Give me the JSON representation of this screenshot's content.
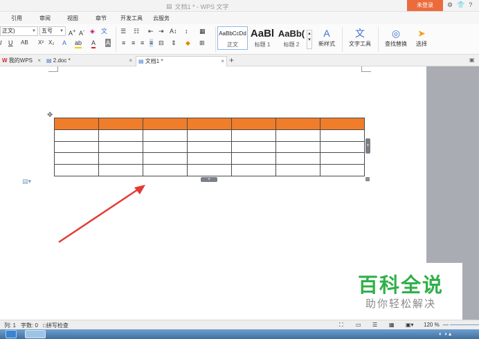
{
  "window": {
    "title": "文档1 * - WPS 文字",
    "login_button": "未登录"
  },
  "menu": [
    "引用",
    "审阅",
    "视图",
    "章节",
    "开发工具",
    "云服务"
  ],
  "ribbon": {
    "font_name": "正文)",
    "font_size": "五号",
    "styles": [
      {
        "preview": "AaBbCcDd",
        "label": "正文"
      },
      {
        "preview": "AaBl",
        "label": "标题 1"
      },
      {
        "preview": "AaBb(",
        "label": "标题 2"
      }
    ],
    "new_style": "新样式",
    "text_tools": "文字工具",
    "find_replace": "查找替换",
    "select": "选择"
  },
  "tabs": [
    {
      "label": "我的WPS"
    },
    {
      "label": "2.doc *"
    },
    {
      "label": "文档1 *"
    }
  ],
  "table": {
    "rows": 5,
    "cols": 7,
    "header_color": "#EF7D2A"
  },
  "watermark": {
    "title": "百科全说",
    "subtitle": "助你轻松解决"
  },
  "status": {
    "column": "列: 1",
    "word_count": "字数: 0",
    "spell_check": "拼写检查",
    "zoom": "120 %"
  },
  "colors": {
    "accent": "#EC6B3C",
    "arrow": "#E53935",
    "watermark_green": "#2FB04A"
  }
}
